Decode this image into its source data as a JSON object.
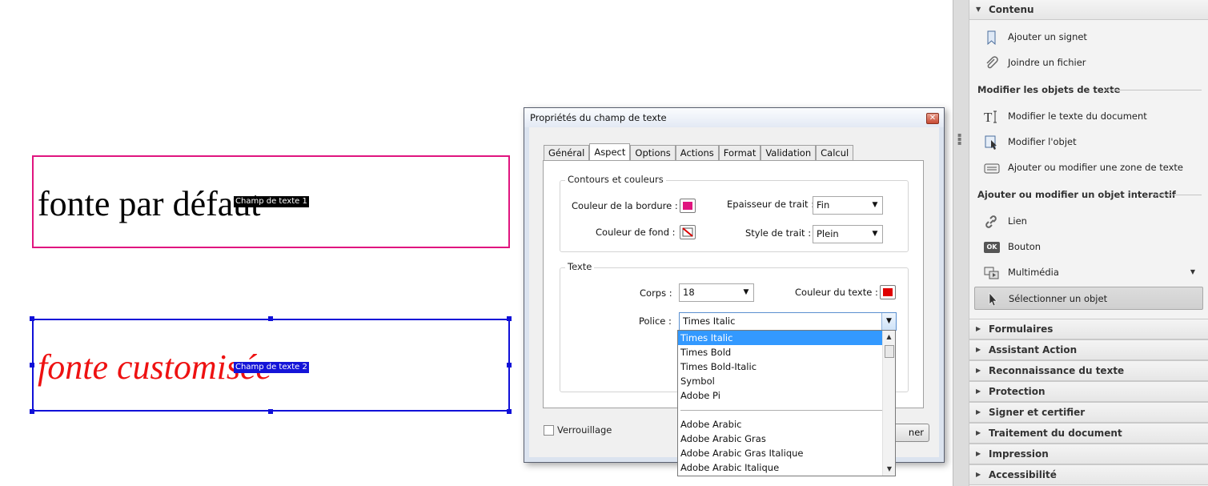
{
  "canvas": {
    "field1": {
      "text": "fonte par défaut",
      "tag": "Champ de texte 1"
    },
    "field2": {
      "text": "fonte customisée",
      "tag": "Champ de texte 2"
    }
  },
  "dialog": {
    "title": "Propriétés du champ de texte",
    "close_glyph": "✕",
    "tabs": [
      "Général",
      "Aspect",
      "Options",
      "Actions",
      "Format",
      "Validation",
      "Calcul"
    ],
    "active_tab": "Aspect",
    "contours": {
      "legend": "Contours et couleurs",
      "border_color_label": "Couleur de la bordure :",
      "border_color": "#e0157f",
      "fill_color_label": "Couleur de fond :",
      "stroke_width_label": "Epaisseur de trait :",
      "stroke_width_value": "Fin",
      "stroke_style_label": "Style de trait :",
      "stroke_style_value": "Plein"
    },
    "texte": {
      "legend": "Texte",
      "size_label": "Corps :",
      "size_value": "18",
      "color_label": "Couleur du texte :",
      "text_color": "#e00000",
      "font_label": "Police :",
      "font_value": "Times Italic"
    },
    "lock_label": "Verrouillage",
    "close_button_label": "ner",
    "font_options": [
      "Times Italic",
      "Times Bold",
      "Times Bold-Italic",
      "Symbol",
      "Adobe Pi",
      "",
      "Adobe Arabic",
      "Adobe Arabic Gras",
      "Adobe Arabic Gras Italique",
      "Adobe Arabic Italique"
    ]
  },
  "panel": {
    "contenu": "Contenu",
    "add_bookmark": "Ajouter un signet",
    "attach_file": "Joindre un fichier",
    "section_text_objects": "Modifier les objets de texte",
    "edit_doc_text": "Modifier le texte du document",
    "edit_object": "Modifier l'objet",
    "add_text_box": "Ajouter ou modifier une zone de texte",
    "section_interactive": "Ajouter ou modifier un objet interactif",
    "link": "Lien",
    "button": "Bouton",
    "multimedia": "Multimédia",
    "select_object": "Sélectionner un objet",
    "ok_badge": "OK",
    "sections": [
      "Formulaires",
      "Assistant Action",
      "Reconnaissance du texte",
      "Protection",
      "Signer et certifier",
      "Traitement du document",
      "Impression",
      "Accessibilité"
    ]
  },
  "colors": {
    "accent_pink": "#e0157f",
    "accent_blue": "#1010d8",
    "select_blue": "#3399ff"
  }
}
